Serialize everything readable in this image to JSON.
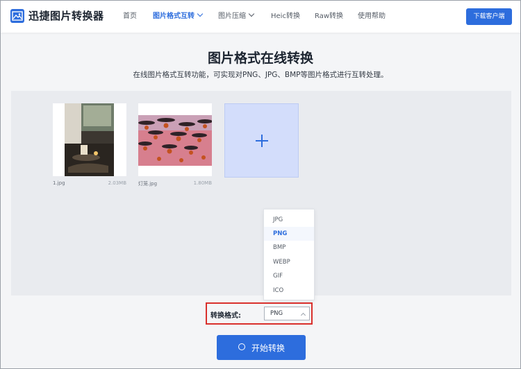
{
  "header": {
    "brand": "迅捷图片转换器",
    "nav": [
      {
        "label": "首页",
        "active": false,
        "has_dropdown": false
      },
      {
        "label": "图片格式互转",
        "active": true,
        "has_dropdown": true
      },
      {
        "label": "图片压缩",
        "active": false,
        "has_dropdown": true
      },
      {
        "label": "Heic转换",
        "active": false,
        "has_dropdown": false
      },
      {
        "label": "Raw转换",
        "active": false,
        "has_dropdown": false
      },
      {
        "label": "使用帮助",
        "active": false,
        "has_dropdown": false
      }
    ],
    "download_label": "下载客户端"
  },
  "hero": {
    "title": "图片格式在线转换",
    "subtitle": "在线图片格式互转功能，可实现对PNG、JPG、BMP等图片格式进行互转处理。"
  },
  "files": [
    {
      "name": "1.jpg",
      "size": "2.03MB"
    },
    {
      "name": "灯笼.jpg",
      "size": "1.80MB"
    }
  ],
  "add_icon": "plus-icon",
  "format": {
    "label": "转换格式:",
    "selected": "PNG",
    "options": [
      "JPG",
      "PNG",
      "BMP",
      "WEBP",
      "GIF",
      "ICO"
    ]
  },
  "start_label": "开始转换",
  "colors": {
    "accent": "#2d6ddd",
    "highlight_border": "#d9302c",
    "add_tile": "#d3ddfb"
  }
}
